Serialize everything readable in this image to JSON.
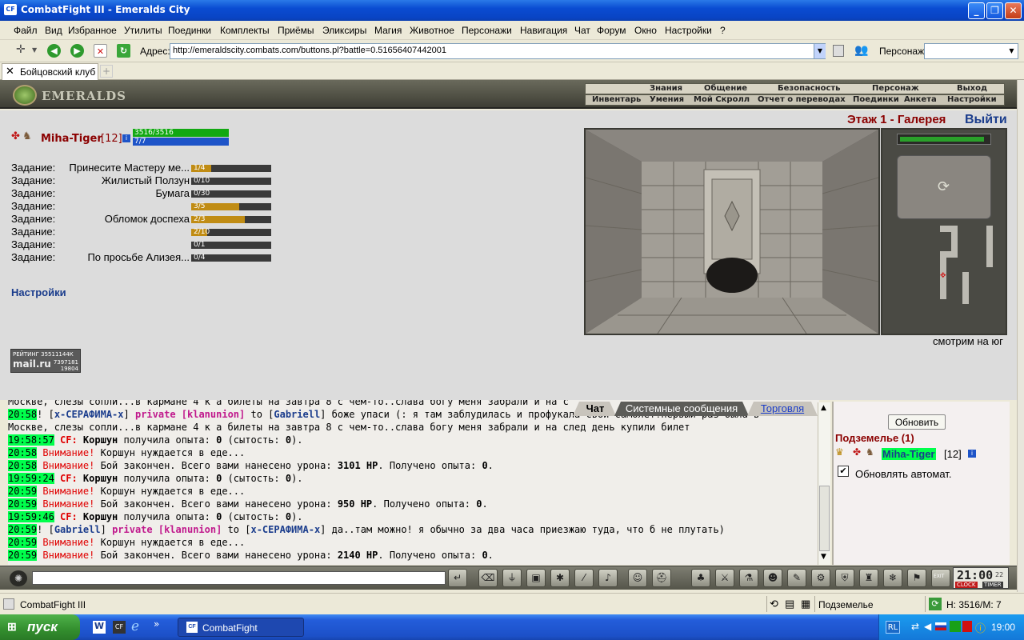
{
  "window": {
    "title": "CombatFight III - Emeralds City",
    "app_icon": "CF"
  },
  "menu": [
    "Файл",
    "Вид",
    "Избранное",
    "Утилиты",
    "Поединки",
    "Комплекты",
    "Приёмы",
    "Эликсиры",
    "Магия",
    "Животное",
    "Персонажи",
    "Навигация",
    "Чат",
    "Форум",
    "Окно",
    "Настройки",
    "?"
  ],
  "address": {
    "label": "Адрес:",
    "url": "http://emeraldscity.combats.com/buttons.pl?battle=0.51656407442001",
    "character_label": "Персонаж:"
  },
  "tab": {
    "label": "Бойцовский клуб"
  },
  "game_header": {
    "logo_text": "EMERALDS",
    "top_tabs": [
      "Знания",
      "Общение",
      "Безопасность",
      "Персонаж",
      "Выход"
    ],
    "sub_tabs": [
      "Инвентарь",
      "Умения",
      "Мой Скролл",
      "Отчет о переводах",
      "Поединки",
      "Анкета",
      "Настройки"
    ]
  },
  "character": {
    "name": "Miha-Tiger",
    "level": "[12]",
    "hp": "3516/3516",
    "mp": "7/7",
    "info_icon": "i"
  },
  "quests": [
    {
      "label": "Задание:",
      "name": "Принесите Мастеру ме...",
      "progress": "1/4",
      "fraction": 0.25
    },
    {
      "label": "Задание:",
      "name": "Жилистый Ползун",
      "progress": "0/10",
      "fraction": 0
    },
    {
      "label": "Задание:",
      "name": "Бумага",
      "progress": "0/30",
      "fraction": 0
    },
    {
      "label": "Задание:",
      "name": "",
      "progress": "3/5",
      "fraction": 0.6
    },
    {
      "label": "Задание:",
      "name": "Обломок доспеха",
      "progress": "2/3",
      "fraction": 0.667
    },
    {
      "label": "Задание:",
      "name": "",
      "progress": "2/10",
      "fraction": 0.2
    },
    {
      "label": "Задание:",
      "name": "",
      "progress": "0/1",
      "fraction": 0
    },
    {
      "label": "Задание:",
      "name": "По просьбе Ализея...",
      "progress": "0/4",
      "fraction": 0
    }
  ],
  "settings_link": "Настройки",
  "rating": {
    "line1": "РЕЙТИНГ 35511144К",
    "brand": "mail.ru",
    "num1": "7397181",
    "num2": "19804"
  },
  "location": {
    "title": "Этаж 1 - Галерея",
    "exit": "Выйти",
    "facing": "смотрим на юг"
  },
  "chat_tabs": [
    "Чат",
    "Системные сообщения",
    "Торговля"
  ],
  "chat_lines": [
    {
      "ts": "",
      "parts": [
        {
          "t": "Москве, слезы сопли...в кармане 4 к а билеты на завтра 8 с чем-то..слава богу меня забрали и на с",
          "c": ""
        }
      ]
    },
    {
      "ts": "20:58",
      "parts": [
        {
          "t": "! [",
          "c": ""
        },
        {
          "t": "х-СЕРАФИМА-х",
          "c": "nick"
        },
        {
          "t": "] ",
          "c": ""
        },
        {
          "t": "private [klanunion]",
          "c": "priv"
        },
        {
          "t": " to [",
          "c": ""
        },
        {
          "t": "Gabriell",
          "c": "nick"
        },
        {
          "t": "] боже упаси (: я там заблудилась и профукала свой самолет!первый раз была в",
          "c": ""
        }
      ]
    },
    {
      "ts": "",
      "parts": [
        {
          "t": "Москве, слезы сопли...в кармане 4 к а билеты на завтра 8 с чем-то..слава богу меня забрали и на след день купили билет",
          "c": ""
        }
      ]
    },
    {
      "ts": "19:58:57",
      "parts": [
        {
          "t": " CF: ",
          "c": "cf"
        },
        {
          "t": "Коршун",
          "c": "b"
        },
        {
          "t": " получила опыта: ",
          "c": ""
        },
        {
          "t": "0",
          "c": "b"
        },
        {
          "t": " (сытость: ",
          "c": ""
        },
        {
          "t": "0",
          "c": "b"
        },
        {
          "t": ").",
          "c": ""
        }
      ]
    },
    {
      "ts": "20:58",
      "parts": [
        {
          "t": " Внимание!",
          "c": "red"
        },
        {
          "t": " Коршун нуждается в еде...",
          "c": ""
        }
      ]
    },
    {
      "ts": "20:58",
      "parts": [
        {
          "t": " Внимание!",
          "c": "red"
        },
        {
          "t": " Бой закончен. Всего вами нанесено урона: ",
          "c": ""
        },
        {
          "t": "3101 HP",
          "c": "b"
        },
        {
          "t": ". Получено опыта: ",
          "c": ""
        },
        {
          "t": "0",
          "c": "b"
        },
        {
          "t": ".",
          "c": ""
        }
      ]
    },
    {
      "ts": "19:59:24",
      "parts": [
        {
          "t": " CF: ",
          "c": "cf"
        },
        {
          "t": "Коршун",
          "c": "b"
        },
        {
          "t": " получила опыта: ",
          "c": ""
        },
        {
          "t": "0",
          "c": "b"
        },
        {
          "t": " (сытость: ",
          "c": ""
        },
        {
          "t": "0",
          "c": "b"
        },
        {
          "t": ").",
          "c": ""
        }
      ]
    },
    {
      "ts": "20:59",
      "parts": [
        {
          "t": " Внимание!",
          "c": "red"
        },
        {
          "t": " Коршун нуждается в еде...",
          "c": ""
        }
      ]
    },
    {
      "ts": "20:59",
      "parts": [
        {
          "t": " Внимание!",
          "c": "red"
        },
        {
          "t": " Бой закончен. Всего вами нанесено урона: ",
          "c": ""
        },
        {
          "t": "950 HP",
          "c": "b"
        },
        {
          "t": ". Получено опыта: ",
          "c": ""
        },
        {
          "t": "0",
          "c": "b"
        },
        {
          "t": ".",
          "c": ""
        }
      ]
    },
    {
      "ts": "19:59:46",
      "parts": [
        {
          "t": " CF: ",
          "c": "cf"
        },
        {
          "t": "Коршун",
          "c": "b"
        },
        {
          "t": " получила опыта: ",
          "c": ""
        },
        {
          "t": "0",
          "c": "b"
        },
        {
          "t": " (сытость: ",
          "c": ""
        },
        {
          "t": "0",
          "c": "b"
        },
        {
          "t": ").",
          "c": ""
        }
      ]
    },
    {
      "ts": "20:59",
      "parts": [
        {
          "t": "! [",
          "c": ""
        },
        {
          "t": "Gabriell",
          "c": "nick"
        },
        {
          "t": "] ",
          "c": ""
        },
        {
          "t": "private [klanunion]",
          "c": "priv"
        },
        {
          "t": " to [",
          "c": ""
        },
        {
          "t": "х-СЕРАФИМА-х",
          "c": "nick"
        },
        {
          "t": "] да..там можно! я обычно за два часа приезжаю туда, что б не плутать)",
          "c": ""
        }
      ]
    },
    {
      "ts": "20:59",
      "parts": [
        {
          "t": " Внимание!",
          "c": "red"
        },
        {
          "t": " Коршун нуждается в еде...",
          "c": ""
        }
      ]
    },
    {
      "ts": "20:59",
      "parts": [
        {
          "t": " Внимание!",
          "c": "red"
        },
        {
          "t": " Бой закончен. Всего вами нанесено урона: ",
          "c": ""
        },
        {
          "t": "2140 HP",
          "c": "b"
        },
        {
          "t": ". Получено опыта: ",
          "c": ""
        },
        {
          "t": "0",
          "c": "b"
        },
        {
          "t": ".",
          "c": ""
        }
      ]
    }
  ],
  "room_panel": {
    "refresh": "Обновить",
    "title": "Подземелье (1)",
    "user": "Miha-Tiger",
    "level": "[12]",
    "auto_checked": "✔",
    "auto_label": "Обновлять автомат."
  },
  "toolbar": {
    "icons": [
      "enter-icon",
      "eraser-icon",
      "filter-icon",
      "save-icon",
      "fighter-icon",
      "split-icon",
      "sound-icon",
      "smiley-icon",
      "helmet-icon"
    ],
    "right_icons": [
      "potion-icon",
      "sword-icon",
      "flask-icon",
      "mask-icon",
      "scroll-icon",
      "gear-icon",
      "armor-icon",
      "castle-icon",
      "snowflake-icon",
      "flag-icon",
      "exit-icon"
    ],
    "exit_label": "EXIT",
    "clock_time": "21:00",
    "clock_sec": "22",
    "clock_label": "CLOCK",
    "timer_label": "TIMER"
  },
  "ie_status": {
    "left": "CombatFight III",
    "zone": "Подземелье",
    "hp_mp": "H: 3516/M: 7"
  },
  "taskbar": {
    "start": "пуск",
    "task": "CombatFight",
    "lang": "RL",
    "time": "19:00"
  }
}
